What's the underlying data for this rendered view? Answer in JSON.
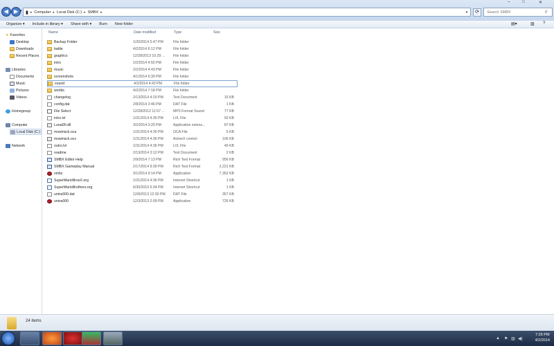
{
  "window": {
    "minimize": "–",
    "maximize": "□",
    "close": "✕"
  },
  "address": {
    "parts": [
      "Computer",
      "Local Disk (C:)",
      "SMBX"
    ],
    "sep": "▸"
  },
  "search": {
    "placeholder": "Search SMBX"
  },
  "toolbar": {
    "organize": "Organize ▾",
    "include": "Include in library ▾",
    "share": "Share with ▾",
    "burn": "Burn",
    "new_folder": "New folder"
  },
  "nav": {
    "favorites": "Favorites",
    "desktop": "Desktop",
    "downloads": "Downloads",
    "recent": "Recent Places",
    "libraries": "Libraries",
    "documents": "Documents",
    "music": "Music",
    "pictures": "Pictures",
    "videos": "Videos",
    "homegroup": "Homegroup",
    "computer": "Computer",
    "localdisk": "Local Disk (C:)",
    "network": "Network"
  },
  "columns": {
    "name": "Name",
    "date": "Date modified",
    "type": "Type",
    "size": "Size"
  },
  "files": [
    {
      "name": "Backup Folder",
      "date": "1/20/2014 5:47 PM",
      "type": "File folder",
      "size": "",
      "icon": "folder"
    },
    {
      "name": "battle",
      "date": "4/2/2014 6:12 PM",
      "type": "File folder",
      "size": "",
      "icon": "folder"
    },
    {
      "name": "graphics",
      "date": "12/28/2013 10:29 ...",
      "type": "File folder",
      "size": "",
      "icon": "folder"
    },
    {
      "name": "intro",
      "date": "2/2/2014 4:55 PM",
      "type": "File folder",
      "size": "",
      "icon": "folder"
    },
    {
      "name": "music",
      "date": "2/2/2014 4:43 PM",
      "type": "File folder",
      "size": "",
      "icon": "folder"
    },
    {
      "name": "screenshots",
      "date": "4/1/2014 6:30 PM",
      "type": "File folder",
      "size": "",
      "icon": "folder"
    },
    {
      "name": "sound",
      "date": "4/2/2014 4:43 PM",
      "type": "File folder",
      "size": "",
      "icon": "folder"
    },
    {
      "name": "worlds",
      "date": "4/2/2014 7:18 PM",
      "type": "File folder",
      "size": "",
      "icon": "folder"
    },
    {
      "name": "changelog",
      "date": "2/13/2014 4:20 PM",
      "type": "Text Document",
      "size": "15 KB",
      "icon": "doc"
    },
    {
      "name": "config.dat",
      "date": "2/8/2014 3:46 PM",
      "type": "DAT File",
      "size": "1 KB",
      "icon": "doc"
    },
    {
      "name": "File Select",
      "date": "12/28/2012 11:57 ...",
      "type": "MP3 Format Sound",
      "size": "77 KB",
      "icon": "snd"
    },
    {
      "name": "intro.lvl",
      "date": "1/31/2014 4:35 PM",
      "type": "LVL File",
      "size": "92 KB",
      "icon": "doc"
    },
    {
      "name": "LunaDll.dll",
      "date": "3/2/2014 3:25 PM",
      "type": "Application extens...",
      "size": "87 KB",
      "icon": "dll"
    },
    {
      "name": "mswinsck.oca",
      "date": "1/31/2014 4:35 PM",
      "type": "OCA File",
      "size": "5 KB",
      "icon": "doc"
    },
    {
      "name": "mswinsck.ocx",
      "date": "1/31/2014 4:36 PM",
      "type": "ActiveX control",
      "size": "106 KB",
      "icon": "dll"
    },
    {
      "name": "outro.lvl",
      "date": "1/31/2014 4:36 PM",
      "type": "LVL File",
      "size": "49 KB",
      "icon": "doc"
    },
    {
      "name": "readme",
      "date": "2/13/2014 3:12 PM",
      "type": "Text Document",
      "size": "2 KB",
      "icon": "doc"
    },
    {
      "name": "SMBX Editor Help",
      "date": "2/9/2014 7:13 PM",
      "type": "Rich Text Format",
      "size": "956 KB",
      "icon": "rtf"
    },
    {
      "name": "SMBX Gameplay Manual",
      "date": "2/17/2014 9:39 PM",
      "type": "Rich Text Format",
      "size": "2,221 KB",
      "icon": "rtf"
    },
    {
      "name": "smbx",
      "date": "3/1/2014 9:14 PM",
      "type": "Application",
      "size": "7,352 KB",
      "icon": "app"
    },
    {
      "name": "SuperMarioBrosX.org",
      "date": "1/31/2014 4:36 PM",
      "type": "Internet Shortcut",
      "size": "1 KB",
      "icon": "lnk"
    },
    {
      "name": "SuperMarioBrothers.org",
      "date": "6/30/2010 5:34 PM",
      "type": "Internet Shortcut",
      "size": "1 KB",
      "icon": "lnk"
    },
    {
      "name": "unins000.dat",
      "date": "12/8/2013 12:30 PM",
      "type": "DAT File",
      "size": "357 KB",
      "icon": "doc"
    },
    {
      "name": "unins000",
      "date": "12/3/2013 2:09 PM",
      "type": "Application",
      "size": "726 KB",
      "icon": "app"
    }
  ],
  "status": {
    "count": "24 items"
  },
  "clock": {
    "time": "7:26 PM",
    "date": "4/2/2014"
  }
}
